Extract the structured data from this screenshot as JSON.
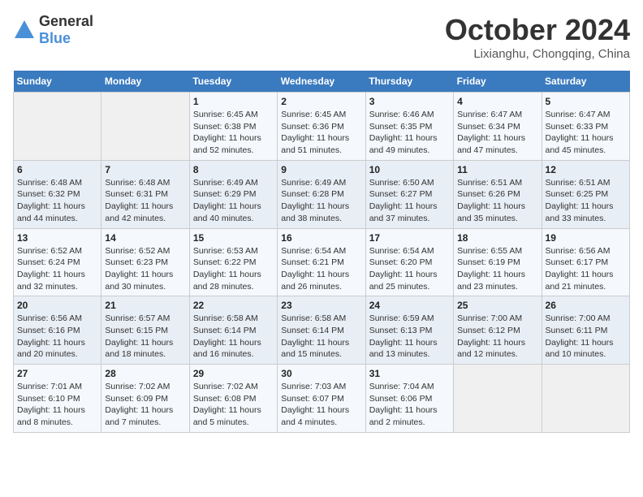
{
  "header": {
    "logo_general": "General",
    "logo_blue": "Blue",
    "month_title": "October 2024",
    "location": "Lixianghu, Chongqing, China"
  },
  "days_of_week": [
    "Sunday",
    "Monday",
    "Tuesday",
    "Wednesday",
    "Thursday",
    "Friday",
    "Saturday"
  ],
  "weeks": [
    [
      {
        "day": "",
        "info": ""
      },
      {
        "day": "",
        "info": ""
      },
      {
        "day": "1",
        "info": "Sunrise: 6:45 AM\nSunset: 6:38 PM\nDaylight: 11 hours and 52 minutes."
      },
      {
        "day": "2",
        "info": "Sunrise: 6:45 AM\nSunset: 6:36 PM\nDaylight: 11 hours and 51 minutes."
      },
      {
        "day": "3",
        "info": "Sunrise: 6:46 AM\nSunset: 6:35 PM\nDaylight: 11 hours and 49 minutes."
      },
      {
        "day": "4",
        "info": "Sunrise: 6:47 AM\nSunset: 6:34 PM\nDaylight: 11 hours and 47 minutes."
      },
      {
        "day": "5",
        "info": "Sunrise: 6:47 AM\nSunset: 6:33 PM\nDaylight: 11 hours and 45 minutes."
      }
    ],
    [
      {
        "day": "6",
        "info": "Sunrise: 6:48 AM\nSunset: 6:32 PM\nDaylight: 11 hours and 44 minutes."
      },
      {
        "day": "7",
        "info": "Sunrise: 6:48 AM\nSunset: 6:31 PM\nDaylight: 11 hours and 42 minutes."
      },
      {
        "day": "8",
        "info": "Sunrise: 6:49 AM\nSunset: 6:29 PM\nDaylight: 11 hours and 40 minutes."
      },
      {
        "day": "9",
        "info": "Sunrise: 6:49 AM\nSunset: 6:28 PM\nDaylight: 11 hours and 38 minutes."
      },
      {
        "day": "10",
        "info": "Sunrise: 6:50 AM\nSunset: 6:27 PM\nDaylight: 11 hours and 37 minutes."
      },
      {
        "day": "11",
        "info": "Sunrise: 6:51 AM\nSunset: 6:26 PM\nDaylight: 11 hours and 35 minutes."
      },
      {
        "day": "12",
        "info": "Sunrise: 6:51 AM\nSunset: 6:25 PM\nDaylight: 11 hours and 33 minutes."
      }
    ],
    [
      {
        "day": "13",
        "info": "Sunrise: 6:52 AM\nSunset: 6:24 PM\nDaylight: 11 hours and 32 minutes."
      },
      {
        "day": "14",
        "info": "Sunrise: 6:52 AM\nSunset: 6:23 PM\nDaylight: 11 hours and 30 minutes."
      },
      {
        "day": "15",
        "info": "Sunrise: 6:53 AM\nSunset: 6:22 PM\nDaylight: 11 hours and 28 minutes."
      },
      {
        "day": "16",
        "info": "Sunrise: 6:54 AM\nSunset: 6:21 PM\nDaylight: 11 hours and 26 minutes."
      },
      {
        "day": "17",
        "info": "Sunrise: 6:54 AM\nSunset: 6:20 PM\nDaylight: 11 hours and 25 minutes."
      },
      {
        "day": "18",
        "info": "Sunrise: 6:55 AM\nSunset: 6:19 PM\nDaylight: 11 hours and 23 minutes."
      },
      {
        "day": "19",
        "info": "Sunrise: 6:56 AM\nSunset: 6:17 PM\nDaylight: 11 hours and 21 minutes."
      }
    ],
    [
      {
        "day": "20",
        "info": "Sunrise: 6:56 AM\nSunset: 6:16 PM\nDaylight: 11 hours and 20 minutes."
      },
      {
        "day": "21",
        "info": "Sunrise: 6:57 AM\nSunset: 6:15 PM\nDaylight: 11 hours and 18 minutes."
      },
      {
        "day": "22",
        "info": "Sunrise: 6:58 AM\nSunset: 6:14 PM\nDaylight: 11 hours and 16 minutes."
      },
      {
        "day": "23",
        "info": "Sunrise: 6:58 AM\nSunset: 6:14 PM\nDaylight: 11 hours and 15 minutes."
      },
      {
        "day": "24",
        "info": "Sunrise: 6:59 AM\nSunset: 6:13 PM\nDaylight: 11 hours and 13 minutes."
      },
      {
        "day": "25",
        "info": "Sunrise: 7:00 AM\nSunset: 6:12 PM\nDaylight: 11 hours and 12 minutes."
      },
      {
        "day": "26",
        "info": "Sunrise: 7:00 AM\nSunset: 6:11 PM\nDaylight: 11 hours and 10 minutes."
      }
    ],
    [
      {
        "day": "27",
        "info": "Sunrise: 7:01 AM\nSunset: 6:10 PM\nDaylight: 11 hours and 8 minutes."
      },
      {
        "day": "28",
        "info": "Sunrise: 7:02 AM\nSunset: 6:09 PM\nDaylight: 11 hours and 7 minutes."
      },
      {
        "day": "29",
        "info": "Sunrise: 7:02 AM\nSunset: 6:08 PM\nDaylight: 11 hours and 5 minutes."
      },
      {
        "day": "30",
        "info": "Sunrise: 7:03 AM\nSunset: 6:07 PM\nDaylight: 11 hours and 4 minutes."
      },
      {
        "day": "31",
        "info": "Sunrise: 7:04 AM\nSunset: 6:06 PM\nDaylight: 11 hours and 2 minutes."
      },
      {
        "day": "",
        "info": ""
      },
      {
        "day": "",
        "info": ""
      }
    ]
  ]
}
